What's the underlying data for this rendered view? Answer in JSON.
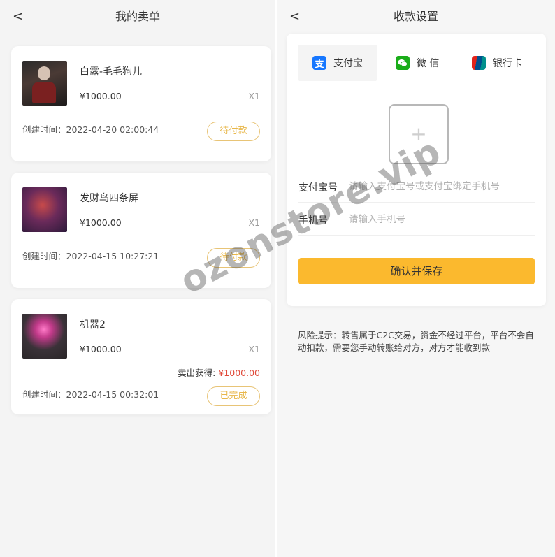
{
  "left": {
    "back": "<",
    "title": "我的卖单",
    "orders": [
      {
        "name": "白露-毛毛狗儿",
        "price": "¥1000.00",
        "qty": "X1",
        "created": "创建时间：2022-04-20 02:00:44",
        "status": "待付款"
      },
      {
        "name": "发财鸟四条屏",
        "price": "¥1000.00",
        "qty": "X1",
        "created": "创建时间：2022-04-15 10:27:21",
        "status": "待付款"
      },
      {
        "name": "机器2",
        "price": "¥1000.00",
        "qty": "X1",
        "earn_label": "卖出获得:",
        "earn_amount": "¥1000.00",
        "created": "创建时间：2022-04-15 00:32:01",
        "status": "已完成"
      }
    ]
  },
  "right": {
    "back": "<",
    "title": "收款设置",
    "tabs": [
      {
        "label": "支付宝",
        "icon": "alipay-icon",
        "glyph": "支"
      },
      {
        "label": "微 信",
        "icon": "wechat-icon"
      },
      {
        "label": "银行卡",
        "icon": "unionpay-icon"
      }
    ],
    "upload_plus": "+",
    "fields": [
      {
        "label": "支付宝号",
        "placeholder": "请输入支付宝号或支付宝绑定手机号"
      },
      {
        "label": "手机号",
        "placeholder": "请输入手机号"
      }
    ],
    "confirm": "确认并保存",
    "risk": "风险提示：转售属于C2C交易，资金不经过平台，平台不会自动扣款，需要您手动转账给对方，对方才能收到款"
  },
  "watermark": "ozonstore.vip",
  "colors": {
    "accent": "#fbb92e",
    "status_border": "#e8c476",
    "earn_red": "#e04a3a"
  }
}
